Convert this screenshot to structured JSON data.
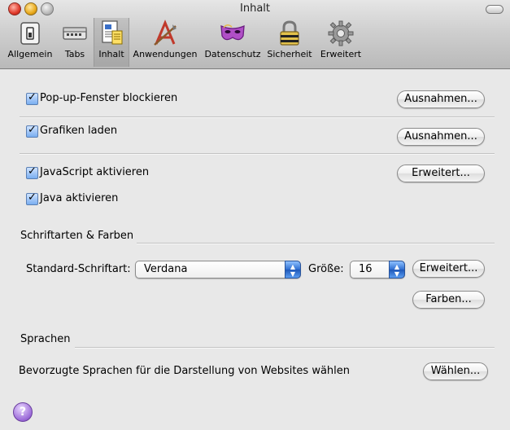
{
  "window": {
    "title": "Inhalt"
  },
  "toolbar": {
    "items": [
      {
        "label": "Allgemein",
        "icon": "general-switch-icon"
      },
      {
        "label": "Tabs",
        "icon": "tabs-icon"
      },
      {
        "label": "Inhalt",
        "icon": "content-document-icon",
        "selected": true
      },
      {
        "label": "Anwendungen",
        "icon": "applications-icon"
      },
      {
        "label": "Datenschutz",
        "icon": "privacy-mask-icon"
      },
      {
        "label": "Sicherheit",
        "icon": "lock-icon"
      },
      {
        "label": "Erweitert",
        "icon": "gear-icon"
      }
    ]
  },
  "content": {
    "popups": {
      "label": "Pop-up-Fenster blockieren",
      "checked": true,
      "button": "Ausnahmen..."
    },
    "images": {
      "label": "Grafiken laden",
      "checked": true,
      "button": "Ausnahmen..."
    },
    "javascript": {
      "label": "JavaScript aktivieren",
      "checked": true,
      "button": "Erweitert..."
    },
    "java": {
      "label": "Java aktivieren",
      "checked": true
    },
    "fonts": {
      "section_title": "Schriftarten & Farben",
      "default_font_label": "Standard-Schriftart:",
      "default_font_value": "Verdana",
      "size_label": "Größe:",
      "size_value": "16",
      "advanced_button": "Erweitert...",
      "colors_button": "Farben..."
    },
    "languages": {
      "section_title": "Sprachen",
      "description": "Bevorzugte Sprachen für die Darstellung von Websites wählen",
      "choose_button": "Wählen..."
    }
  },
  "colors": {
    "accent": "#2f6fd1",
    "help": "#9b6ad8"
  }
}
